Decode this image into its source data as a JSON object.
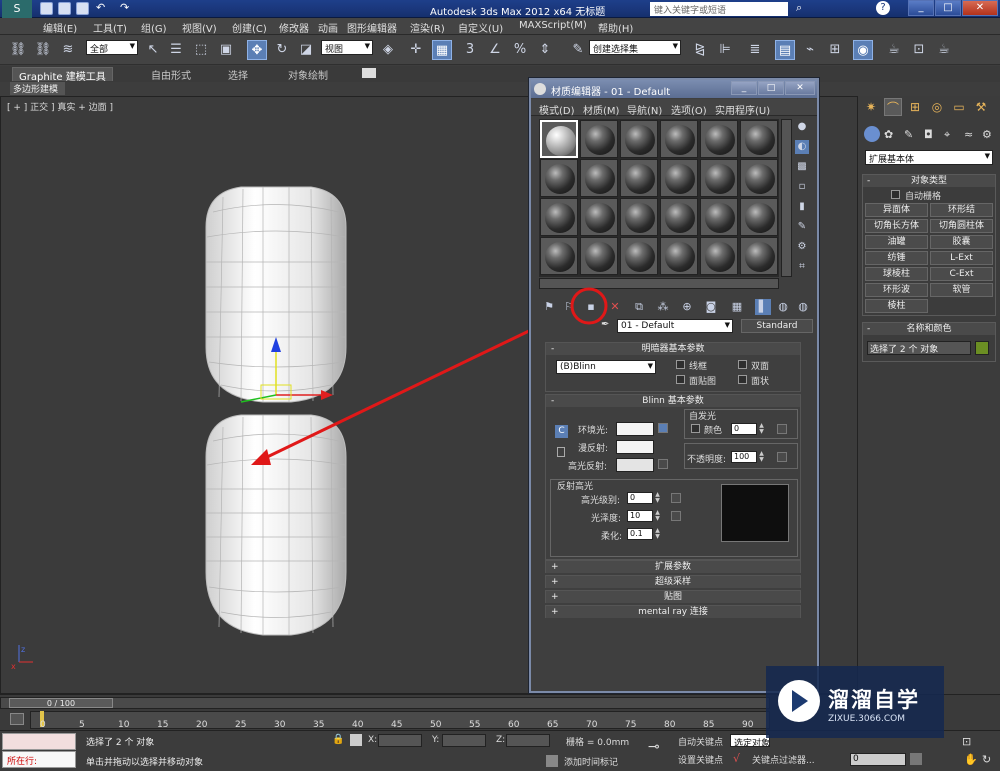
{
  "app": {
    "title": "Autodesk 3ds Max  2012 x64     无标题",
    "search_placeholder": "键入关键字或短语"
  },
  "menu": [
    "编辑(E)",
    "工具(T)",
    "组(G)",
    "视图(V)",
    "创建(C)",
    "修改器",
    "动画",
    "图形编辑器",
    "渲染(R)",
    "自定义(U)",
    "MAXScript(M)",
    "帮助(H)"
  ],
  "toolbar": {
    "selection_filter": "全部",
    "coord_system": "视图",
    "named_selection": "创建选择集",
    "snap_label": "3"
  },
  "ribbon": {
    "tabs": [
      "Graphite 建模工具",
      "自由形式",
      "选择",
      "对象绘制"
    ],
    "sub_label": "多边形建模"
  },
  "viewport": {
    "label": "[ + ] 正交 ] 真实 + 边面 ]"
  },
  "material_editor": {
    "title": "材质编辑器 - 01 - Default",
    "menu": [
      "模式(D)",
      "材质(M)",
      "导航(N)",
      "选项(O)",
      "实用程序(U)"
    ],
    "material_name": "01 - Default",
    "material_type": "Standard",
    "shader_section": {
      "title": "明暗器基本参数",
      "shader": "(B)Blinn",
      "wire": "线框",
      "two_sided": "双面",
      "face_map": "面贴图",
      "faceted": "面状"
    },
    "blinn_section": {
      "title": "Blinn 基本参数",
      "self_illum": "自发光",
      "color": "颜色",
      "color_value": "0",
      "ambient": "环境光:",
      "diffuse": "漫反射:",
      "specular": "高光反射:",
      "opacity": "不透明度:",
      "opacity_value": "100",
      "spec_highlights": "反射高光",
      "spec_level": "高光级别:",
      "spec_level_value": "0",
      "glossiness": "光泽度:",
      "glossiness_value": "10",
      "soften": "柔化:",
      "soften_value": "0.1",
      "lock_c": "C"
    },
    "collapsed_sections": [
      "扩展参数",
      "超级采样",
      "贴图",
      "mental ray 连接"
    ]
  },
  "command_panel": {
    "category": "扩展基本体",
    "object_type_title": "对象类型",
    "autogrid": "自动栅格",
    "objects": [
      "异面体",
      "环形结",
      "切角长方体",
      "切角圆柱体",
      "油罐",
      "胶囊",
      "纺锤",
      "L-Ext",
      "球棱柱",
      "C-Ext",
      "环形波",
      "软管",
      "棱柱"
    ],
    "name_color_title": "名称和颜色",
    "name_value": "选择了 2 个 对象",
    "object_color": "#6b8e23"
  },
  "timeline": {
    "frame_counter": "0 / 100",
    "ticks": [
      "0",
      "5",
      "10",
      "15",
      "20",
      "25",
      "30",
      "35",
      "40",
      "45",
      "50",
      "55",
      "60",
      "65",
      "70",
      "75",
      "80",
      "85",
      "90"
    ]
  },
  "status": {
    "running_label": "所在行:",
    "selected": "选择了 2 个 对象",
    "prompt": "单击并拖动以选择并移动对象",
    "x_label": "X:",
    "y_label": "Y:",
    "z_label": "Z:",
    "grid": "栅格 = 0.0mm",
    "add_time_tag": "添加时间标记",
    "auto_key": "自动关键点",
    "set_key": "设置关键点",
    "selected_obj": "选定对象",
    "key_filters": "关键点过滤器...",
    "frame_value": "0"
  },
  "watermark": {
    "text": "溜溜自学",
    "url": "ZIXUE.3066.COM"
  },
  "colors": {
    "highlight_red": "#e01818",
    "accent_blue": "#5b7fb5"
  }
}
